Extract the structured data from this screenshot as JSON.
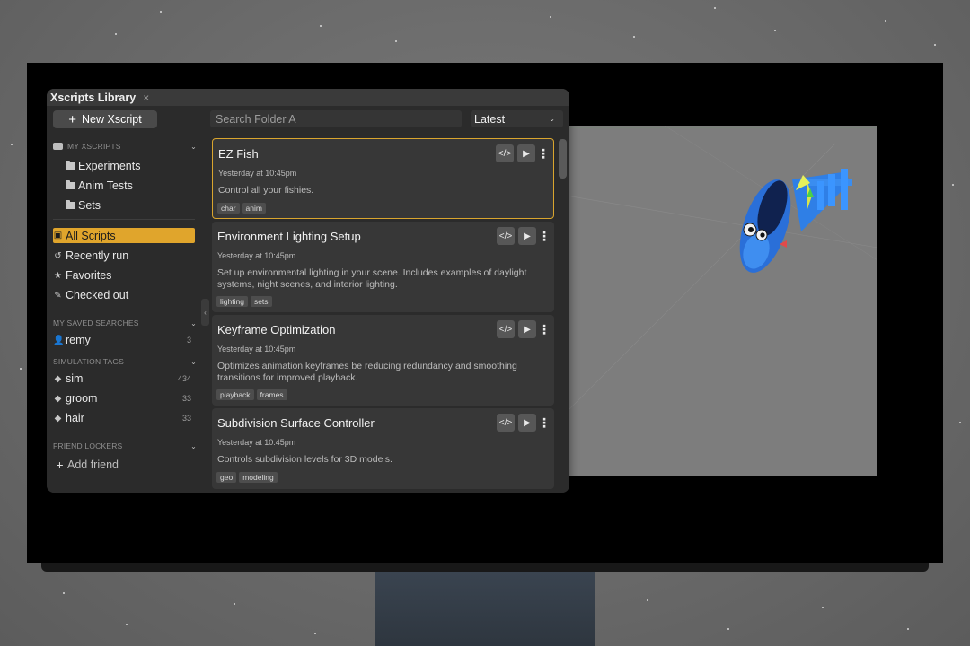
{
  "library": {
    "title": "Xscripts Library",
    "close_glyph": "×",
    "new_button": {
      "icon": "plus-icon",
      "label": "New Xscript"
    },
    "search": {
      "placeholder": "Search Folder A"
    },
    "sort": {
      "selected": "Latest"
    },
    "sections": {
      "my_xscripts": "MY XSCRIPTS",
      "saved_searches": "MY SAVED SEARCHES",
      "simulation_tags": "SIMULATION TAGS",
      "friend_lockers": "FRIEND LOCKERS"
    },
    "folders": [
      "Experiments",
      "Anim Tests",
      "Sets"
    ],
    "nav": [
      "All Scripts",
      "Recently run",
      "Favorites",
      "Checked out"
    ],
    "saved_searches": [
      {
        "label": "remy",
        "count": "3"
      }
    ],
    "tags": [
      {
        "label": "sim",
        "count": "434"
      },
      {
        "label": "groom",
        "count": "33"
      },
      {
        "label": "hair",
        "count": "33"
      }
    ],
    "add_friend": "Add friend",
    "accent_color": "#e0a52c"
  },
  "scripts": [
    {
      "title": "EZ Fish",
      "time": "Yesterday at 10:45pm",
      "desc": "Control all your fishies.",
      "tags": [
        "char",
        "anim"
      ]
    },
    {
      "title": "Environment Lighting Setup",
      "time": "Yesterday at 10:45pm",
      "desc": "Set up environmental lighting in your scene. Includes examples of daylight systems, night scenes, and interior lighting.",
      "tags": [
        "lighting",
        "sets"
      ]
    },
    {
      "title": "Keyframe Optimization",
      "time": "Yesterday at 10:45pm",
      "desc": "Optimizes animation keyframes be reducing redundancy and smoothing transitions for improved playback.",
      "tags": [
        "playback",
        "frames"
      ]
    },
    {
      "title": "Subdivision Surface Controller",
      "time": "Yesterday at 10:45pm",
      "desc": "Controls subdivision levels for 3D models.",
      "tags": [
        "geo",
        "modeling"
      ]
    }
  ]
}
